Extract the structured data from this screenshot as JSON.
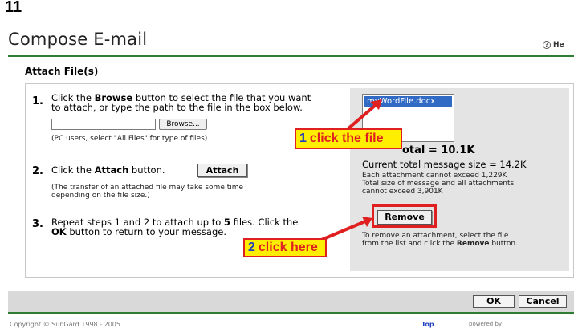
{
  "step_number": "11",
  "header": {
    "title": "Compose E-mail",
    "help": "He",
    "help_glyph": "?"
  },
  "section": {
    "title": "Attach File(s)"
  },
  "steps": {
    "s1": {
      "num": "1.",
      "pre": "Click the ",
      "bold": "Browse",
      "line1_post": " button to select the file that you want",
      "line2": "to attach, or type the path to the file in the box below.",
      "browse_label": "Browse...",
      "note": "(PC users, select \"All Files\" for type of files)"
    },
    "s2": {
      "num": "2.",
      "pre": "Click the ",
      "bold": "Attach",
      "post": " button.",
      "attach_label": "Attach",
      "note1": "(The transfer of an attached file may take some time",
      "note2": "depending on the file size.)"
    },
    "s3": {
      "num": "3.",
      "line1_pre": "Repeat steps 1 and 2 to attach up to ",
      "line1_bold": "5",
      "line1_post": " files. Click the",
      "line2_bold": "OK",
      "line2_post": " button to return to your message."
    }
  },
  "attachments": {
    "files": [
      "myWordFile.docx"
    ],
    "total_text": "otal = 10.1K",
    "current_size": "Current total message size = 14.2K",
    "limit1": "Each attachment cannot exceed 1,229K",
    "limit2": "Total size of message and all attachments",
    "limit3": "cannot exceed 3,901K",
    "remove_label": "Remove",
    "remove_help_line1": "To remove an attachment, select the file",
    "remove_help_pre": "from the list and click the ",
    "remove_help_bold": "Remove",
    "remove_help_post": " button."
  },
  "callouts": {
    "c1": {
      "num": "1",
      "text": "click the file"
    },
    "c2": {
      "num": "2",
      "text": "click here"
    }
  },
  "buttons": {
    "ok": "OK",
    "cancel": "Cancel"
  },
  "footer": {
    "copyright": "Copyright © SunGard 1998 - 2005",
    "top": "Top",
    "powered": "powered by"
  },
  "colors": {
    "highlight": "#e02020",
    "callout_bg": "#ffee00",
    "accent_green": "#2e7d32",
    "selection": "#316ac5"
  }
}
